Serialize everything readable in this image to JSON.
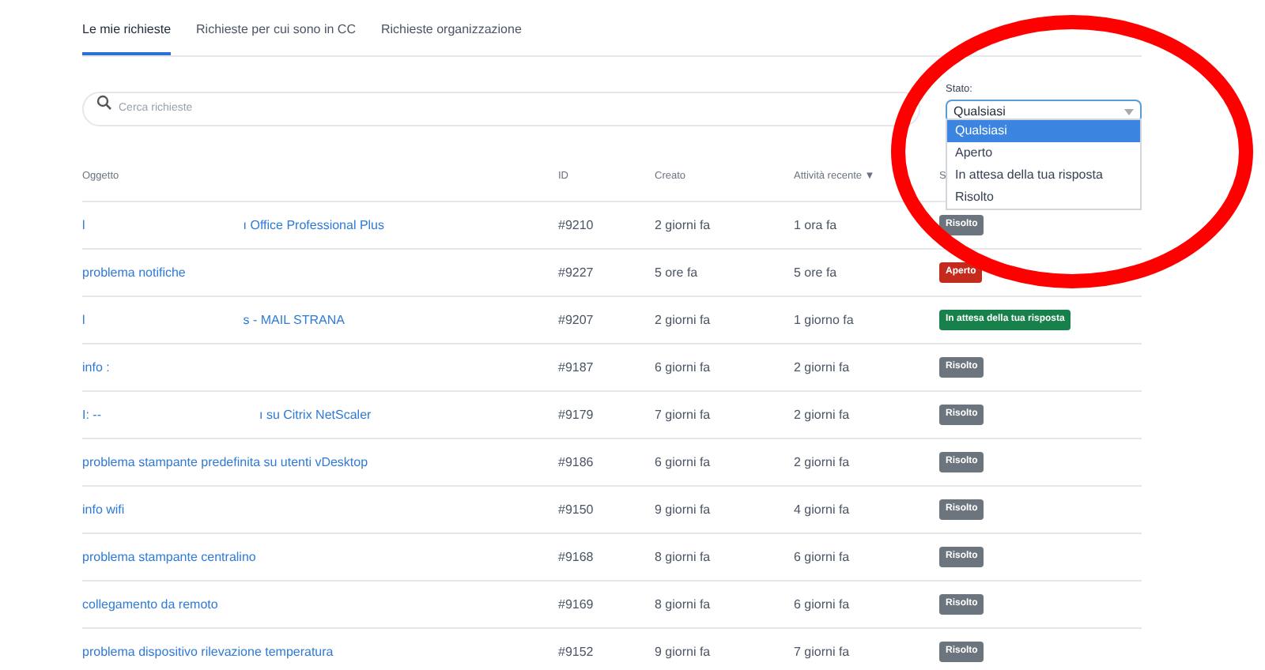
{
  "tabs": [
    {
      "label": "Le mie richieste",
      "selected": true
    },
    {
      "label": "Richieste per cui sono in CC",
      "selected": false
    },
    {
      "label": "Richieste organizzazione",
      "selected": false
    }
  ],
  "search": {
    "placeholder": "Cerca richieste"
  },
  "status_filter": {
    "label": "Stato:",
    "value": "Qualsiasi",
    "expanded": true,
    "options": [
      {
        "label": "Qualsiasi",
        "selected": true
      },
      {
        "label": "Aperto",
        "selected": false
      },
      {
        "label": "In attesa della tua risposta",
        "selected": false
      },
      {
        "label": "Risolto",
        "selected": false
      }
    ]
  },
  "table": {
    "columns": [
      "Oggetto",
      "ID",
      "Creato",
      "Attività recente ▼",
      "S"
    ],
    "rows": [
      {
        "subject": [
          "l",
          "ı Office Professional Plus"
        ],
        "id": "#9210",
        "created": "2 giorni fa",
        "activity": "1 ora fa",
        "status": "Risolto",
        "color": "#6c757d"
      },
      {
        "subject": [
          "problema notifiche"
        ],
        "id": "#9227",
        "created": "5 ore fa",
        "activity": "5 ore fa",
        "status": "Aperto",
        "color": "#c42b1c"
      },
      {
        "subject": [
          "l",
          "s - MAIL STRANA"
        ],
        "id": "#9207",
        "created": "2 giorni fa",
        "activity": "1 giorno fa",
        "status": "In attesa della tua risposta",
        "color": "#18804b"
      },
      {
        "subject": [
          "info :"
        ],
        "id": "#9187",
        "created": "6 giorni fa",
        "activity": "2 giorni fa",
        "status": "Risolto",
        "color": "#6c757d"
      },
      {
        "subject": [
          "I: --",
          "ı su Citrix NetScaler"
        ],
        "id": "#9179",
        "created": "7 giorni fa",
        "activity": "2 giorni fa",
        "status": "Risolto",
        "color": "#6c757d"
      },
      {
        "subject": [
          "problema stampante predefinita su utenti vDesktop"
        ],
        "id": "#9186",
        "created": "6 giorni fa",
        "activity": "2 giorni fa",
        "status": "Risolto",
        "color": "#6c757d"
      },
      {
        "subject": [
          "info wifi"
        ],
        "id": "#9150",
        "created": "9 giorni fa",
        "activity": "4 giorni fa",
        "status": "Risolto",
        "color": "#6c757d"
      },
      {
        "subject": [
          "problema stampante centralino"
        ],
        "id": "#9168",
        "created": "8 giorni fa",
        "activity": "6 giorni fa",
        "status": "Risolto",
        "color": "#6c757d"
      },
      {
        "subject": [
          "collegamento da remoto"
        ],
        "id": "#9169",
        "created": "8 giorni fa",
        "activity": "6 giorni fa",
        "status": "Risolto",
        "color": "#6c757d"
      },
      {
        "subject": [
          "problema dispositivo rilevazione temperatura"
        ],
        "id": "#9152",
        "created": "9 giorni fa",
        "activity": "7 giorni fa",
        "status": "Risolto",
        "color": "#6c757d"
      }
    ]
  }
}
